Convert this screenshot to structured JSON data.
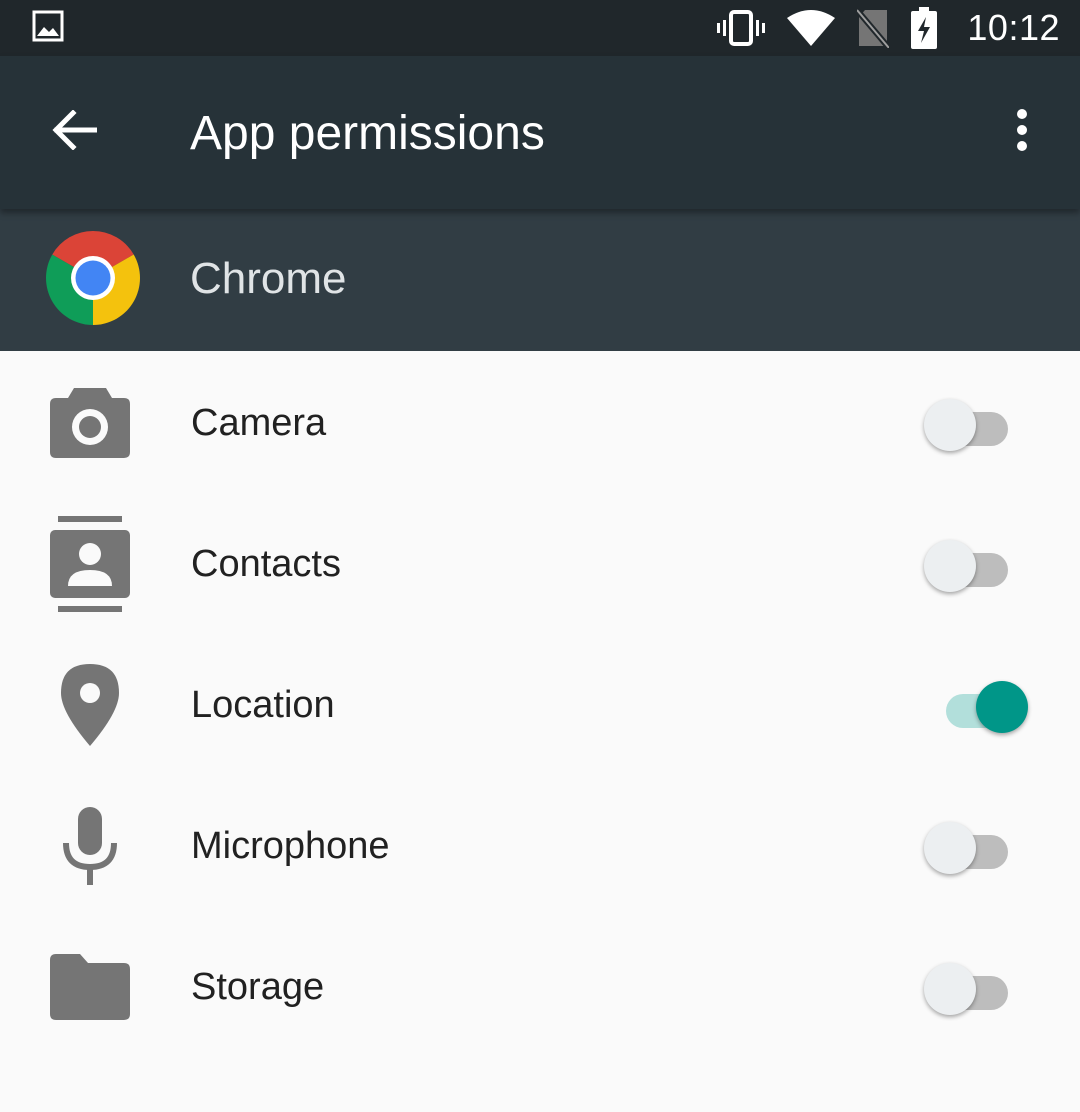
{
  "status_bar": {
    "time": "10:12",
    "icons": [
      "image-notification-icon",
      "vibrate-icon",
      "wifi-icon",
      "no-sim-icon",
      "battery-charging-icon"
    ]
  },
  "app_bar": {
    "title": "App permissions",
    "back_icon": "arrow-back-icon",
    "overflow_icon": "more-vert-icon"
  },
  "app_header": {
    "name": "Chrome",
    "icon": "chrome-logo-icon"
  },
  "permissions": [
    {
      "label": "Camera",
      "icon": "camera-icon",
      "enabled": false
    },
    {
      "label": "Contacts",
      "icon": "contacts-icon",
      "enabled": false
    },
    {
      "label": "Location",
      "icon": "location-icon",
      "enabled": true
    },
    {
      "label": "Microphone",
      "icon": "microphone-icon",
      "enabled": false
    },
    {
      "label": "Storage",
      "icon": "folder-icon",
      "enabled": false
    }
  ],
  "colors": {
    "status_bar_bg": "#20272b",
    "app_bar_bg": "#263238",
    "app_header_bg": "#313d44",
    "switch_on_thumb": "#009688",
    "switch_on_track": "#b2dfdb",
    "switch_off_track": "#bdbdbd",
    "list_icon": "#757575"
  }
}
